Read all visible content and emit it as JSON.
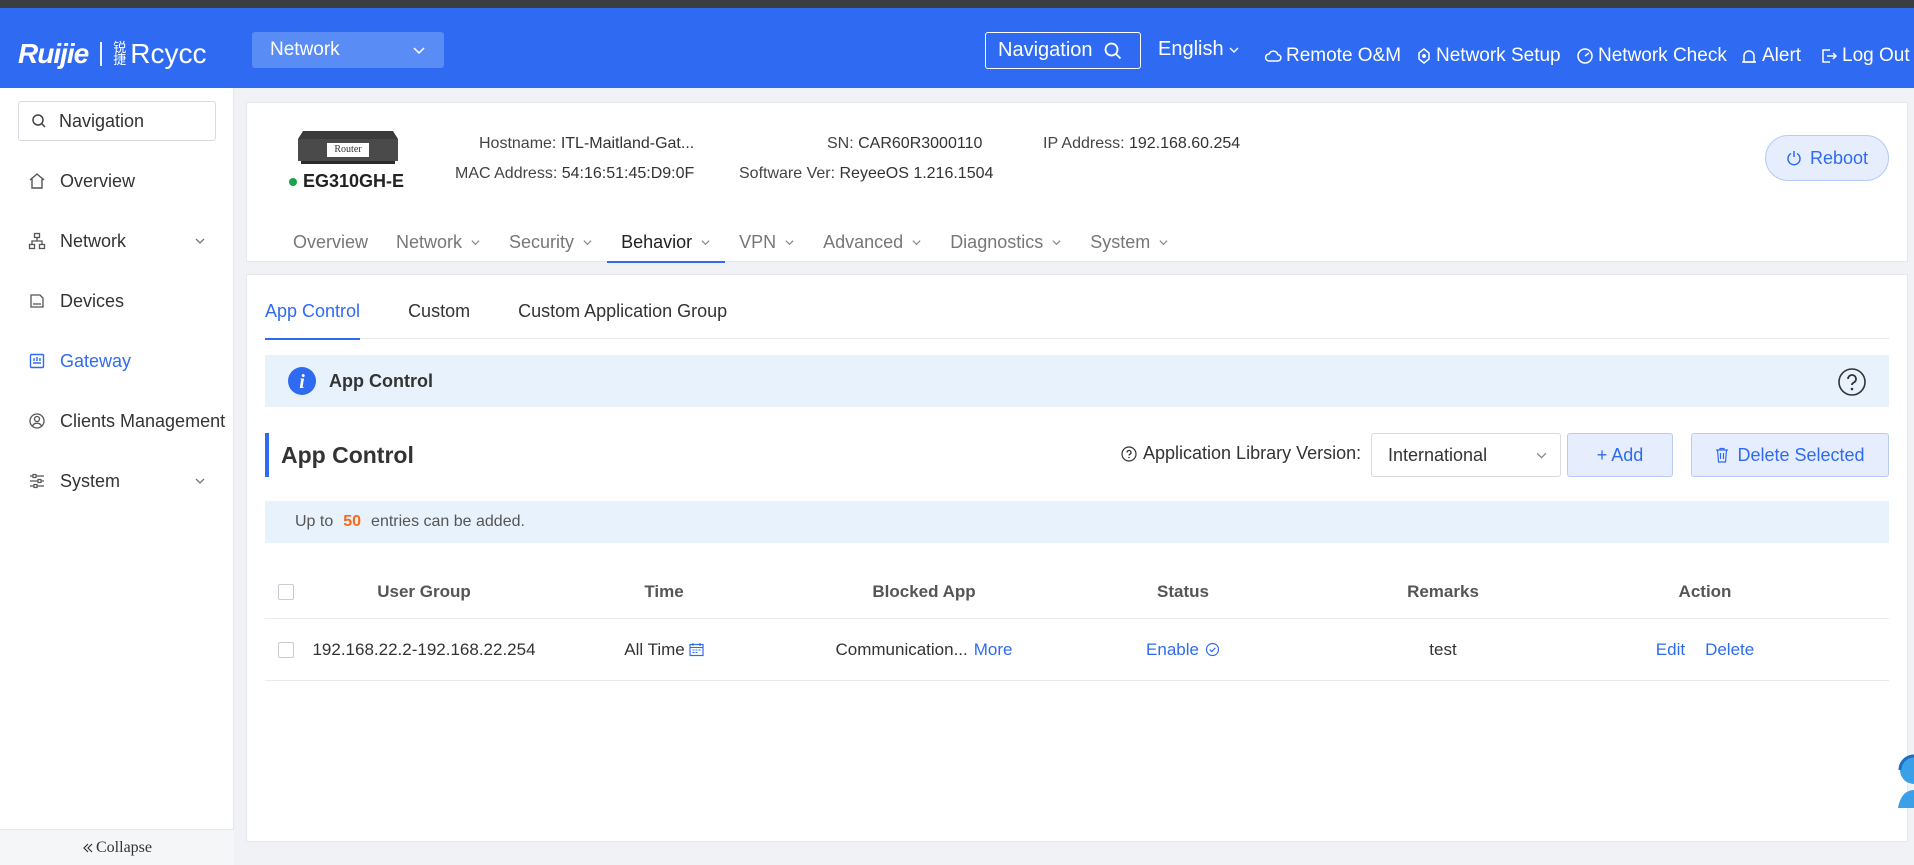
{
  "header": {
    "logo_primary": "Ruijie",
    "logo_mark": "锐捷",
    "logo_secondary": "Rcycc",
    "network_select": "Network",
    "navigation_button": "Navigation",
    "language": "English",
    "remote_om": "Remote O&M",
    "network_setup": "Network Setup",
    "network_check": "Network Check",
    "alert": "Alert",
    "logout": "Log Out",
    "accent_color": "#2f6bf2"
  },
  "sidebar": {
    "search_placeholder": "Navigation",
    "items": [
      {
        "label": "Overview",
        "icon": "home-icon"
      },
      {
        "label": "Network",
        "icon": "network-topology-icon"
      },
      {
        "label": "Devices",
        "icon": "device-icon"
      },
      {
        "label": "Gateway",
        "icon": "gateway-icon"
      },
      {
        "label": "Clients Management",
        "icon": "user-circle-icon"
      },
      {
        "label": "System",
        "icon": "settings-sliders-icon"
      }
    ],
    "collapse_label": "Collapse"
  },
  "device": {
    "image_label": "Router",
    "model": "EG310GH-E",
    "status_color": "#1aa34a",
    "hostname_label": "Hostname:",
    "hostname": "ITL-Maitland-Gat...",
    "mac_label": "MAC Address:",
    "mac": "54:16:51:45:D9:0F",
    "sn_label": "SN:",
    "sn": "CAR60R3000110",
    "software_label": "Software Ver:",
    "software": "ReyeeOS 1.216.1504",
    "ip_label": "IP Address:",
    "ip": "192.168.60.254",
    "reboot_label": "Reboot"
  },
  "top_tabs": [
    {
      "label": "Overview"
    },
    {
      "label": "Network"
    },
    {
      "label": "Security"
    },
    {
      "label": "Behavior"
    },
    {
      "label": "VPN"
    },
    {
      "label": "Advanced"
    },
    {
      "label": "Diagnostics"
    },
    {
      "label": "System"
    }
  ],
  "sub_tabs": [
    {
      "label": "App Control"
    },
    {
      "label": "Custom"
    },
    {
      "label": "Custom Application Group"
    }
  ],
  "banner": {
    "title": "App Control"
  },
  "section": {
    "title": "App Control",
    "library_label": "Application Library Version:",
    "library_value": "International",
    "add_label": "+ Add",
    "delete_selected_label": "Delete Selected"
  },
  "limit": {
    "prefix": "Up to",
    "count": "50",
    "suffix": "entries can be added."
  },
  "table": {
    "headers": [
      "User Group",
      "Time",
      "Blocked App",
      "Status",
      "Remarks",
      "Action"
    ],
    "rows": [
      {
        "user_group": "192.168.22.2-192.168.22.254",
        "time": "All Time",
        "blocked_app": "Communication...",
        "more": "More",
        "status": "Enable",
        "remarks": "test",
        "edit": "Edit",
        "delete": "Delete"
      }
    ]
  }
}
